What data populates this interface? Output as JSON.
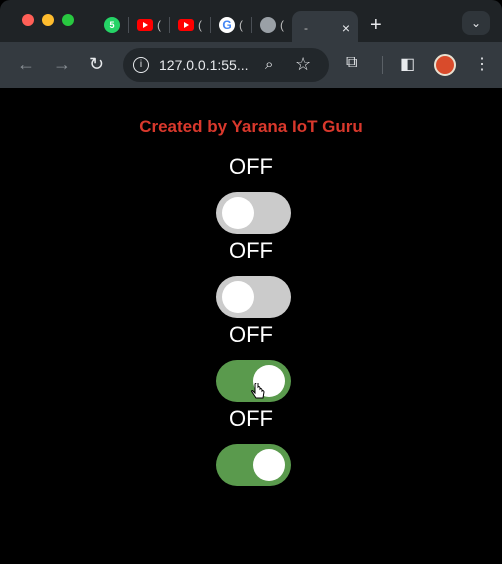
{
  "browser": {
    "tabs": [
      {
        "icon": "whatsapp-icon",
        "label": "5"
      },
      {
        "icon": "youtube-icon",
        "label": "("
      },
      {
        "icon": "youtube-icon",
        "label": "("
      },
      {
        "icon": "google-icon",
        "label": "("
      },
      {
        "icon": "globe-icon",
        "label": "("
      }
    ],
    "active_tab": {
      "title": "-",
      "close": "×"
    },
    "new_tab": "+",
    "menu_chevron": "⌄",
    "url": "127.0.0.1:55...",
    "nav": {
      "back": "←",
      "forward": "→",
      "reload": "↻"
    }
  },
  "page": {
    "heading": "Created by Yarana IoT Guru",
    "heading_color": "#d9382c",
    "switches": [
      {
        "label": "OFF",
        "on": false
      },
      {
        "label": "OFF",
        "on": false
      },
      {
        "label": "OFF",
        "on": true
      },
      {
        "label": "OFF",
        "on": true
      }
    ],
    "switch_on_color": "#5a9a4d",
    "switch_off_color": "#cbcbcb"
  }
}
